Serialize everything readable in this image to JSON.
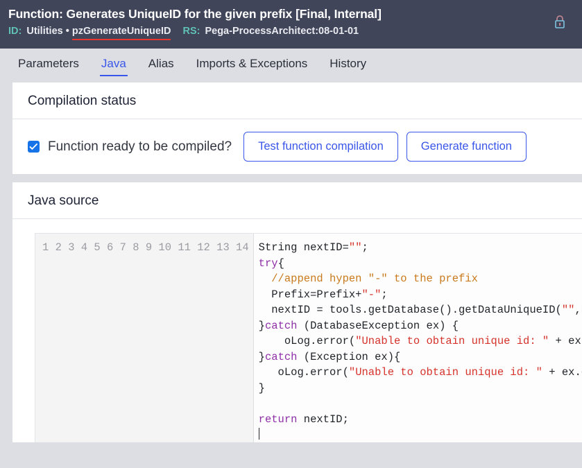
{
  "header": {
    "title": "Function: Generates UniqueID for the given prefix [Final, Internal]",
    "id_label": "ID:",
    "id_ruleset": "Utilities •",
    "id_name": "pzGenerateUniqueID",
    "rs_label": "RS:",
    "rs_value": "Pega-ProcessArchitect:08-01-01",
    "lock_icon": "lock-icon",
    "background_color": "#414559",
    "accent_teal": "#5fc1b8",
    "underline_color": "#e8352e"
  },
  "tabs": [
    {
      "label": "Parameters",
      "active": false
    },
    {
      "label": "Java",
      "active": true
    },
    {
      "label": "Alias",
      "active": false
    },
    {
      "label": "Imports & Exceptions",
      "active": false
    },
    {
      "label": "History",
      "active": false
    }
  ],
  "compilation": {
    "section_title": "Compilation status",
    "checkbox_label": "Function ready to be compiled?",
    "checkbox_checked": true,
    "checkbox_color": "#1673e8",
    "test_button": "Test function compilation",
    "generate_button": "Generate function",
    "button_color": "#3a56e8"
  },
  "java_source": {
    "section_title": "Java source",
    "line_numbers": [
      "1",
      "2",
      "3",
      "4",
      "5",
      "6",
      "7",
      "8",
      "9",
      "10",
      "11",
      "12",
      "13",
      "14"
    ],
    "lines": [
      "String nextID=\"\";",
      "try{",
      "  //append hypen \"-\" to the prefix",
      "  Prefix=Prefix+\"-\";",
      "  nextID = tools.getDatabase().getDataUniqueID(\"\",Prefix,\"\");",
      "}catch (DatabaseException ex) {",
      "    oLog.error(\"Unable to obtain unique id: \" + ex.getMessage());",
      "}catch (Exception ex){",
      "   oLog.error(\"Unable to obtain unique id: \" + ex.getMessage());",
      "}",
      "",
      "return nextID;",
      "",
      ""
    ],
    "cursor_line": 13,
    "syntax_colors": {
      "keyword": "#8f2fa8",
      "string": "#d6332c",
      "comment": "#c97a1c",
      "plain": "#1f2328"
    }
  }
}
